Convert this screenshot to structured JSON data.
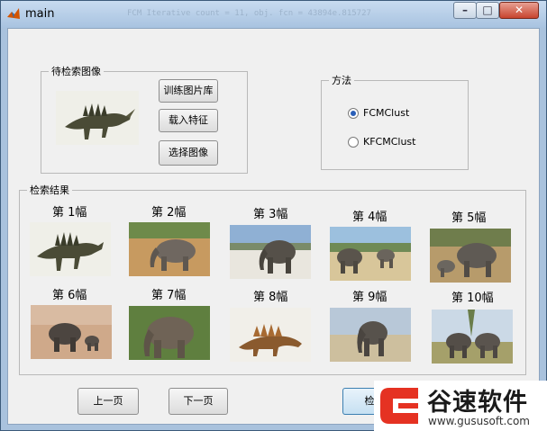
{
  "window": {
    "title": "main",
    "ghost_text": "FCM Iterative count = 11, obj. fcn = 43894e.815727"
  },
  "query_group": {
    "title": "待检索图像"
  },
  "buttons": {
    "train_library": "训练图片库",
    "load_features": "载入特征",
    "select_image": "选择图像",
    "prev_page": "上一页",
    "next_page": "下一页",
    "search": "检"
  },
  "method_group": {
    "title": "方法",
    "options": [
      {
        "label": "FCMClust",
        "selected": true
      },
      {
        "label": "KFCMClust",
        "selected": false
      }
    ]
  },
  "results_group": {
    "title": "检索结果",
    "items": [
      {
        "label": "第 1幅",
        "icon": "dinosaur"
      },
      {
        "label": "第 2幅",
        "icon": "elephant"
      },
      {
        "label": "第 3幅",
        "icon": "elephant"
      },
      {
        "label": "第 4幅",
        "icon": "elephant"
      },
      {
        "label": "第 5幅",
        "icon": "elephant"
      },
      {
        "label": "第 6幅",
        "icon": "elephant"
      },
      {
        "label": "第 7幅",
        "icon": "elephant"
      },
      {
        "label": "第 8幅",
        "icon": "dinosaur"
      },
      {
        "label": "第 9幅",
        "icon": "elephant"
      },
      {
        "label": "第 10幅",
        "icon": "elephant"
      }
    ]
  },
  "watermark": {
    "name": "谷速软件",
    "url": "www.gususoft.com",
    "accent": "#e53222"
  }
}
